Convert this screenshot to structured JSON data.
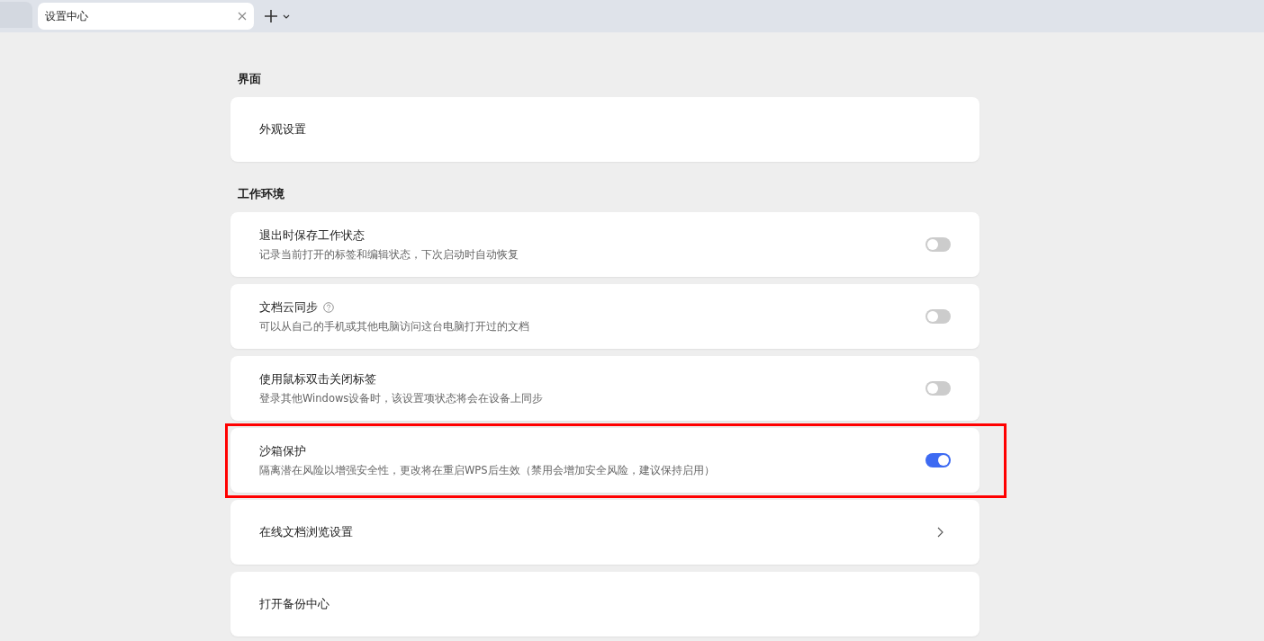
{
  "tabs": [
    {
      "label": "设置中心",
      "selected": true
    }
  ],
  "sections": [
    {
      "title": "界面",
      "items": [
        {
          "kind": "plain",
          "title": "外观设置"
        }
      ]
    },
    {
      "title": "工作环境",
      "items": [
        {
          "kind": "toggle",
          "title": "退出时保存工作状态",
          "description": "记录当前打开的标签和编辑状态，下次启动时自动恢复",
          "on": false
        },
        {
          "kind": "toggle",
          "title": "文档云同步",
          "help": true,
          "description": "可以从自己的手机或其他电脑访问这台电脑打开过的文档",
          "on": false
        },
        {
          "kind": "toggle",
          "title": "使用鼠标双击关闭标签",
          "description": "登录其他Windows设备时，该设置项状态将会在设备上同步",
          "on": false
        },
        {
          "kind": "toggle",
          "title": "沙箱保护",
          "description": "隔离潜在风险以增强安全性，更改将在重启WPS后生效（禁用会增加安全风险，建议保持启用）",
          "on": true,
          "highlighted": true
        },
        {
          "kind": "link",
          "title": "在线文档浏览设置"
        },
        {
          "kind": "plain",
          "title": "打开备份中心"
        }
      ]
    }
  ]
}
